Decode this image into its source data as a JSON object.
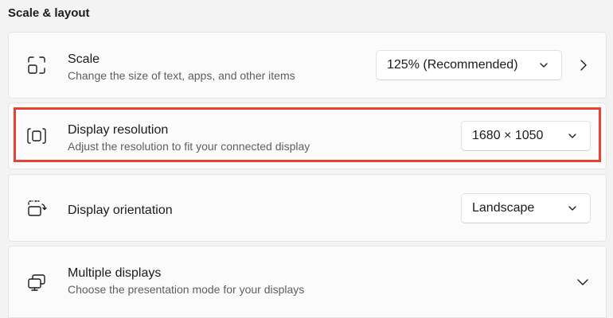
{
  "section": {
    "title": "Scale & layout"
  },
  "scale": {
    "title": "Scale",
    "subtitle": "Change the size of text, apps, and other items",
    "value": "125% (Recommended)",
    "icon": "scale-icon"
  },
  "resolution": {
    "title": "Display resolution",
    "subtitle": "Adjust the resolution to fit your connected display",
    "value": "1680 × 1050",
    "icon": "resolution-icon"
  },
  "orientation": {
    "title": "Display orientation",
    "value": "Landscape",
    "icon": "orientation-icon"
  },
  "multiple": {
    "title": "Multiple displays",
    "subtitle": "Choose the presentation mode for your displays",
    "icon": "multiple-displays-icon"
  },
  "colors": {
    "highlight": "#e34234",
    "card_bg": "#fbfbfb",
    "page_bg": "#f3f3f3"
  }
}
